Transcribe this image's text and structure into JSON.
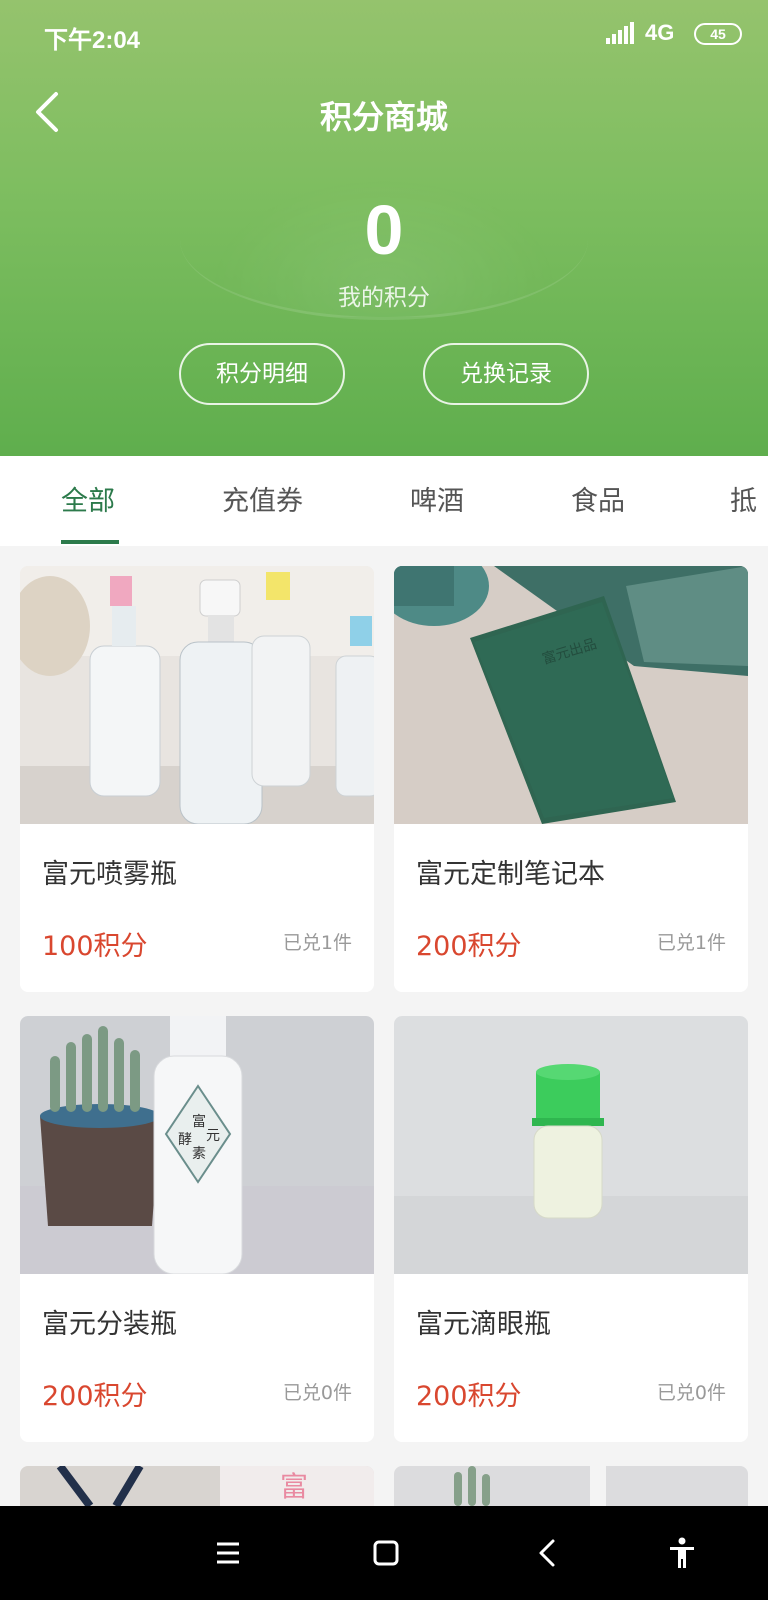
{
  "status_bar": {
    "time": "下午2:04",
    "network": "4G",
    "battery": "45"
  },
  "header": {
    "title": "积分商城",
    "points_value": "0",
    "points_label": "我的积分",
    "detail_button": "积分明细",
    "record_button": "兑换记录"
  },
  "tabs": [
    {
      "label": "全部",
      "active": true
    },
    {
      "label": "充值券"
    },
    {
      "label": "啤酒"
    },
    {
      "label": "食品"
    },
    {
      "label": "抵"
    }
  ],
  "products": [
    {
      "name": "富元喷雾瓶",
      "price": "100积分",
      "sold": "已兑1件"
    },
    {
      "name": "富元定制笔记本",
      "price": "200积分",
      "sold": "已兑1件"
    },
    {
      "name": "富元分装瓶",
      "price": "200积分",
      "sold": "已兑0件"
    },
    {
      "name": "富元滴眼瓶",
      "price": "200积分",
      "sold": "已兑0件"
    }
  ],
  "icons": {
    "back": "chevron-left-icon",
    "signal": "signal-icon",
    "nav_menu": "menu-icon",
    "nav_home": "home-square-icon",
    "nav_back": "back-icon",
    "nav_accessibility": "accessibility-icon"
  },
  "colors": {
    "header_green": "#7cbd5f",
    "active_tab": "#2c7a4b",
    "price_red": "#d9472f"
  }
}
